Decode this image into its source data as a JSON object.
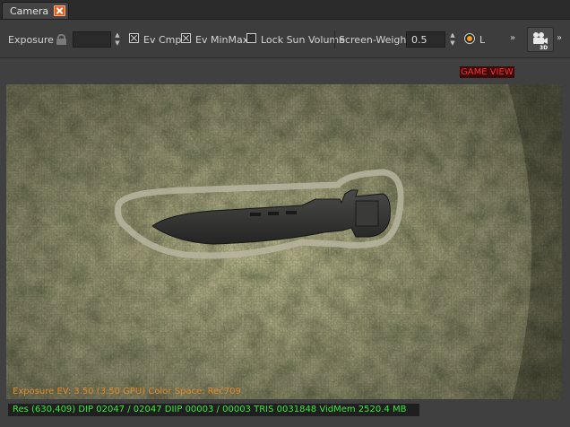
{
  "tab": {
    "label": "Camera"
  },
  "toolbar": {
    "exposure_label": "Exposure",
    "exposure_value": "",
    "ev_cmp_label": "Ev Cmp",
    "ev_cmp_checked": true,
    "ev_minmax_label": "Ev MinMax",
    "ev_minmax_checked": true,
    "lock_sun_label": "Lock Sun Volume",
    "lock_sun_checked": false,
    "screen_weight_label": "Screen-Weight",
    "screen_weight_value": "0.5",
    "radio_label": "L",
    "overflow_1": "»",
    "overflow_2": "»",
    "camera_mode_label": "3D"
  },
  "viewport": {
    "game_view_label": "GAME VIEW",
    "exposure_info": "Exposure EV: 3.50 (3.50 GPU)  Color Space: Rec709",
    "stats": "Res (630,409)   DIP 02047 / 02047  DIIP 00003 / 00003  TRIS 0031848  VidMem 2520.4 MB"
  },
  "colors": {
    "accent_orange": "#e35d12",
    "game_view_red": "#ff2a2a",
    "exposure_text": "#e08a2a",
    "stats_green": "#38e838"
  }
}
